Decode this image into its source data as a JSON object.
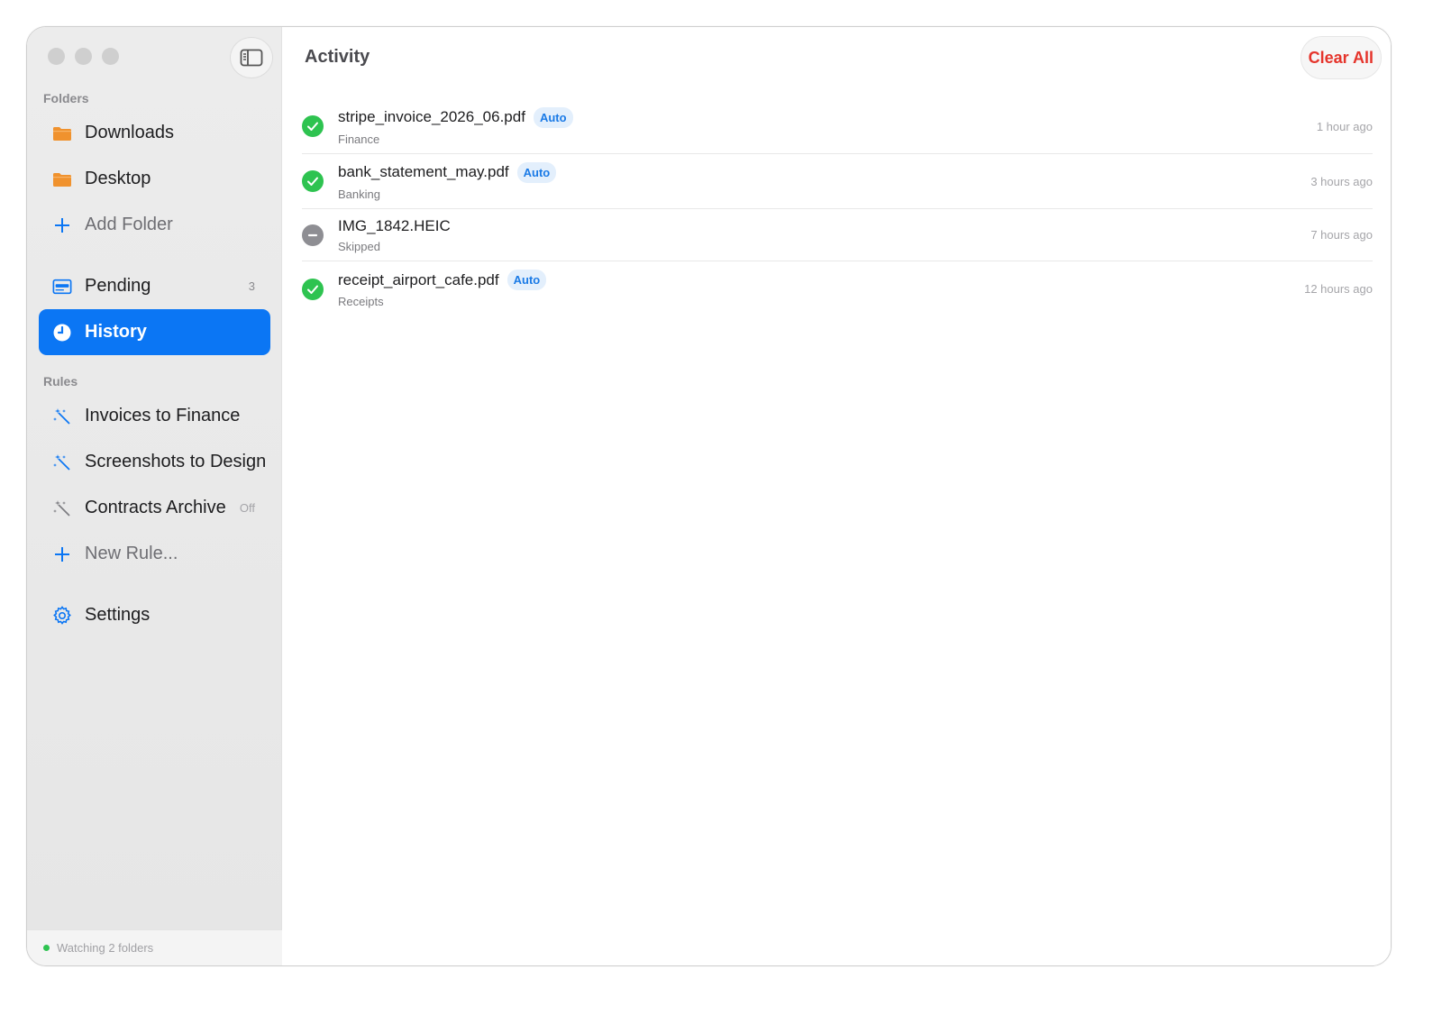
{
  "sidebar": {
    "folders_label": "Folders",
    "folders": [
      {
        "label": "Downloads",
        "icon": "folder-icon"
      },
      {
        "label": "Desktop",
        "icon": "folder-icon"
      }
    ],
    "add_folder": "Add Folder",
    "pending": {
      "label": "Pending",
      "count": "3"
    },
    "history": {
      "label": "History"
    },
    "rules_label": "Rules",
    "rules": [
      {
        "label": "Invoices to Finance",
        "state": ""
      },
      {
        "label": "Screenshots to Design",
        "state": ""
      },
      {
        "label": "Contracts Archive",
        "state": "Off"
      }
    ],
    "new_rule": "New Rule...",
    "settings": "Settings",
    "status": "Watching 2 folders"
  },
  "main": {
    "title": "Activity",
    "clear_all": "Clear All",
    "items": [
      {
        "file": "stripe_invoice_2026_06.pdf",
        "badge": "Auto",
        "category": "Finance",
        "time": "1 hour ago",
        "status": "ok"
      },
      {
        "file": "bank_statement_may.pdf",
        "badge": "Auto",
        "category": "Banking",
        "time": "3 hours ago",
        "status": "ok"
      },
      {
        "file": "IMG_1842.HEIC",
        "badge": "",
        "category": "Skipped",
        "time": "7 hours ago",
        "status": "skip"
      },
      {
        "file": "receipt_airport_cafe.pdf",
        "badge": "Auto",
        "category": "Receipts",
        "time": "12 hours ago",
        "status": "ok"
      }
    ]
  },
  "colors": {
    "accent": "#0b76f4",
    "folder": "#f0922e",
    "success": "#2ec350",
    "danger": "#e5342b",
    "skipped": "#8e8e93"
  }
}
